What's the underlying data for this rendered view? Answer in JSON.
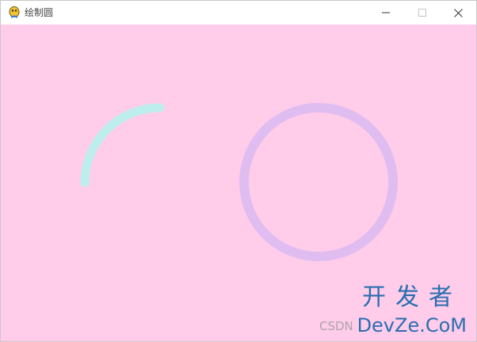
{
  "window": {
    "title": "绘制圆",
    "title_color": "#444444",
    "controls": {
      "minimize_icon": "minimize-icon",
      "maximize_icon": "maximize-icon",
      "close_icon": "close-icon"
    }
  },
  "canvas": {
    "background": "#ffccea",
    "shapes": [
      {
        "kind": "arc",
        "color": "#bdeeed"
      },
      {
        "kind": "circle",
        "color": "#dfbdf1"
      }
    ]
  },
  "watermark": {
    "chinese": "开发者",
    "csdn": "CSDN",
    "english": "DevZe.CoM",
    "color": "#2a6fb0"
  }
}
